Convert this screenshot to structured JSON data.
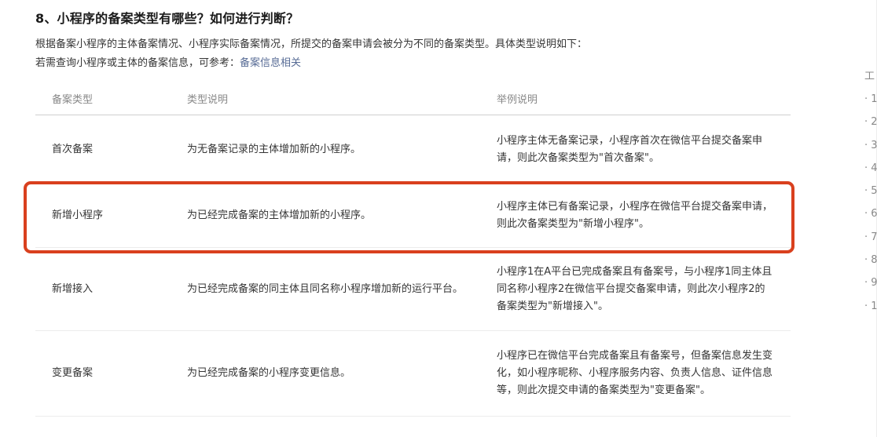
{
  "heading": "8、小程序的备案类型有哪些？如何进行判断？",
  "intro": {
    "line1": "根据备案小程序的主体备案情况、小程序实际备案情况，所提交的备案申请会被分为不同的备案类型。具体类型说明如下：",
    "line2_prefix": "若需查询小程序或主体的备案信息，可参考：",
    "link": "备案信息相关"
  },
  "table": {
    "headers": [
      "备案类型",
      "类型说明",
      "举例说明"
    ],
    "rows": [
      {
        "type": "首次备案",
        "desc": "为无备案记录的主体增加新的小程序。",
        "example": "小程序主体无备案记录，小程序首次在微信平台提交备案申请，则此次备案类型为\"首次备案\"。"
      },
      {
        "type": "新增小程序",
        "desc": "为已经完成备案的主体增加新的小程序。",
        "example": "小程序主体已有备案记录，小程序在微信平台提交备案申请，则此次备案类型为\"新增小程序\"。"
      },
      {
        "type": "新增接入",
        "desc": "为已经完成备案的同主体且同名称小程序增加新的运行平台。",
        "example": "小程序1在A平台已完成备案且有备案号，与小程序1同主体且同名称小程序2在微信平台提交备案申请，则此次小程序2的备案类型为\"新增接入\"。"
      },
      {
        "type": "变更备案",
        "desc": "为已经完成备案的小程序变更信息。",
        "example": "小程序已在微信平台完成备案且有备案号，但备案信息发生变化，如小程序昵称、小程序服务内容、负责人信息、证件信息等，则此次提交申请的备案类型为\"变更备案\"。"
      }
    ]
  },
  "side_nav": {
    "title": "工",
    "items": [
      "· 1",
      "· 2",
      "· 3",
      "· 4",
      "· 5",
      "· 6",
      "· 7",
      "· 8",
      "· 9",
      "· 1"
    ]
  },
  "colors": {
    "highlight_border": "#d9401e",
    "link": "#576b95"
  }
}
